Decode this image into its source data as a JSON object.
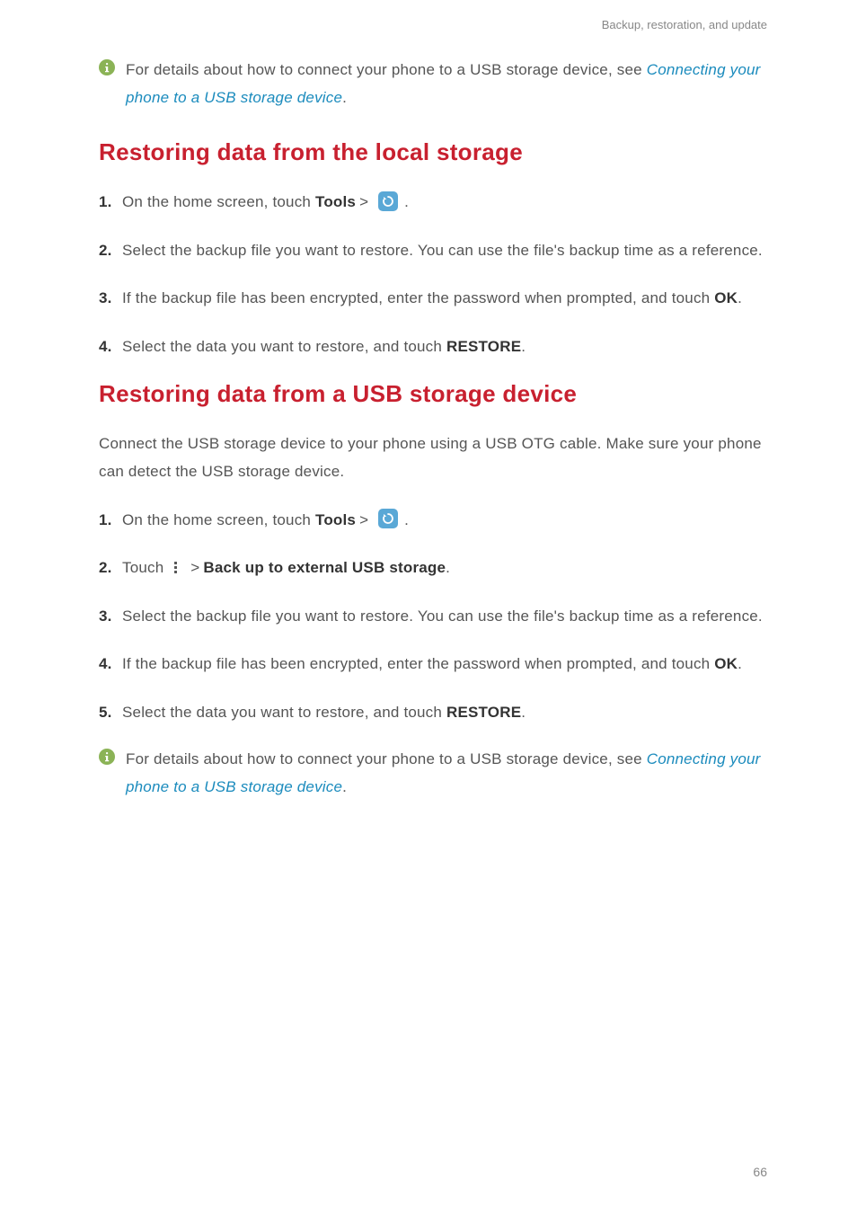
{
  "header": {
    "breadcrumb": "Backup, restoration, and update"
  },
  "info1": {
    "text_a": "For details about how to connect your phone to a USB storage device, see ",
    "link": "Connecting your phone to a USB storage device",
    "text_b": "."
  },
  "section1": {
    "heading": "Restoring data from the local storage",
    "steps": {
      "s1": {
        "num": "1.",
        "pre": "On the home screen, touch ",
        "tools": "Tools",
        "post": " ."
      },
      "s2": {
        "num": "2.",
        "text": "Select the backup file you want to restore. You can use the file's backup time as a reference."
      },
      "s3": {
        "num": "3.",
        "text_a": "If the backup file has been encrypted, enter the password when prompted, and touch ",
        "ok": "OK",
        "text_b": "."
      },
      "s4": {
        "num": "4.",
        "text_a": "Select the data you want to restore, and touch ",
        "restore": "RESTORE",
        "text_b": "."
      }
    }
  },
  "section2": {
    "heading": "Restoring data from a USB storage device",
    "intro": "Connect the USB storage device to your phone using a USB OTG cable. Make sure your phone can detect the USB storage device.",
    "steps": {
      "s1": {
        "num": "1.",
        "pre": "On the home screen, touch ",
        "tools": "Tools",
        "post": " ."
      },
      "s2": {
        "num": "2.",
        "pre": "Touch ",
        "backup_label": "Back up to external USB storage",
        "post": "."
      },
      "s3": {
        "num": "3.",
        "text": "Select the backup file you want to restore. You can use the file's backup time as a reference."
      },
      "s4": {
        "num": "4.",
        "text_a": "If the backup file has been encrypted, enter the password when prompted, and touch ",
        "ok": "OK",
        "text_b": "."
      },
      "s5": {
        "num": "5.",
        "text_a": "Select the data you want to restore, and touch ",
        "restore": "RESTORE",
        "text_b": "."
      }
    }
  },
  "info2": {
    "text_a": "For details about how to connect your phone to a USB storage device, see ",
    "link": "Connecting your phone to a USB storage device",
    "text_b": "."
  },
  "page_number": "66",
  "icons": {
    "info": "info-icon",
    "backup_app": "backup-app-icon",
    "overflow_menu": "overflow-menu-icon"
  }
}
